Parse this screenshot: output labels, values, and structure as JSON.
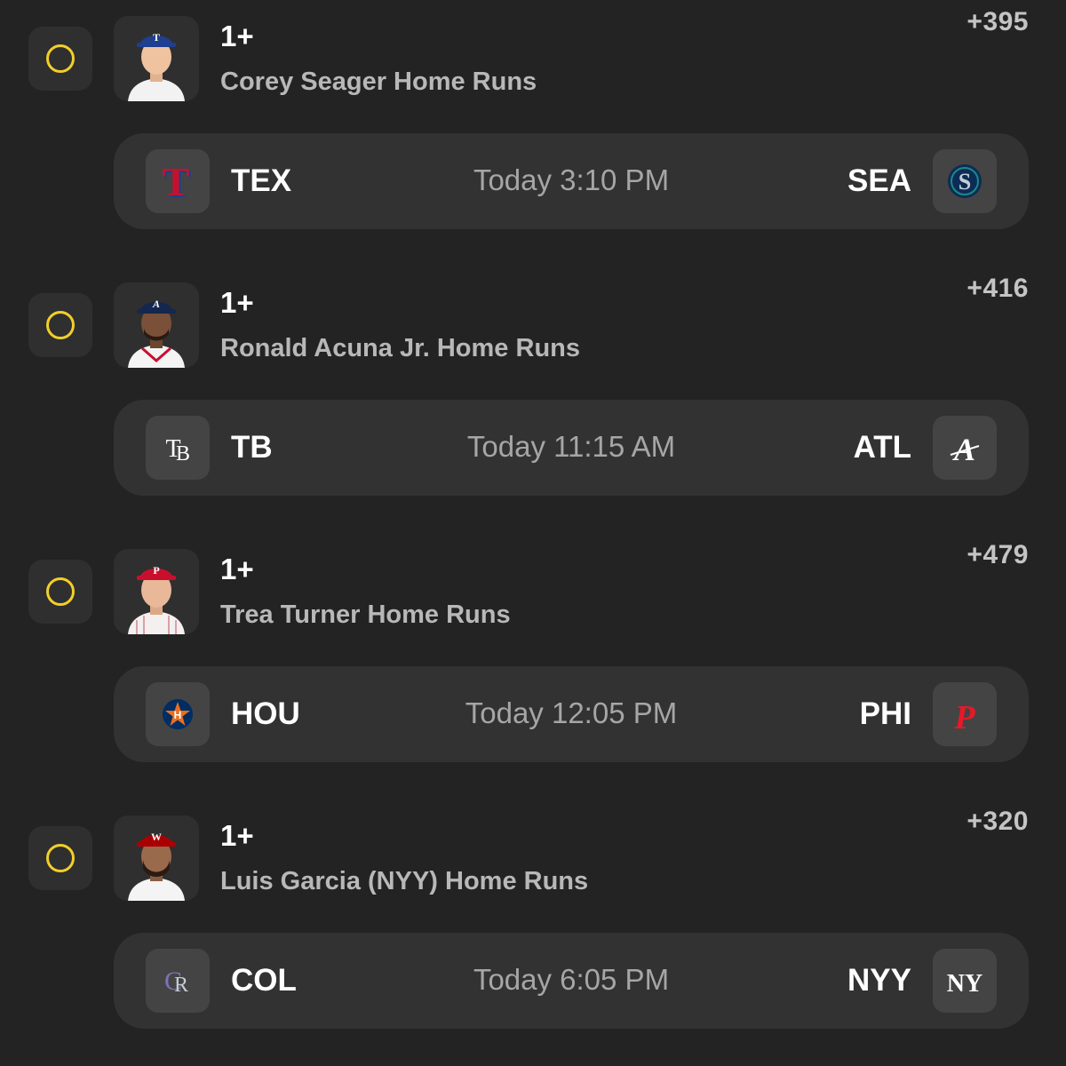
{
  "colors": {
    "background": "#232323",
    "card": "#323232",
    "radio_ring": "#f2cf2a",
    "odds_text": "#c4c4c4",
    "market_text": "#b8b8b8"
  },
  "bets": [
    {
      "line": "1+",
      "market": "Corey Seager Home Runs",
      "odds": "+395",
      "player_icon": "player-headshot-rangers",
      "game": {
        "left_team": "TEX",
        "left_logo": "rangers-logo",
        "time": "Today 3:10 PM",
        "right_team": "SEA",
        "right_logo": "mariners-logo"
      }
    },
    {
      "line": "1+",
      "market": "Ronald Acuna Jr. Home Runs",
      "odds": "+416",
      "player_icon": "player-headshot-braves",
      "game": {
        "left_team": "TB",
        "left_logo": "rays-logo",
        "time": "Today 11:15 AM",
        "right_team": "ATL",
        "right_logo": "braves-logo"
      }
    },
    {
      "line": "1+",
      "market": "Trea Turner Home Runs",
      "odds": "+479",
      "player_icon": "player-headshot-phillies",
      "game": {
        "left_team": "HOU",
        "left_logo": "astros-logo",
        "time": "Today 12:05 PM",
        "right_team": "PHI",
        "right_logo": "phillies-logo"
      }
    },
    {
      "line": "1+",
      "market": "Luis Garcia (NYY) Home Runs",
      "odds": "+320",
      "player_icon": "player-headshot-nationals",
      "game": {
        "left_team": "COL",
        "left_logo": "rockies-logo",
        "time": "Today 6:05 PM",
        "right_team": "NYY",
        "right_logo": "yankees-logo"
      }
    }
  ]
}
